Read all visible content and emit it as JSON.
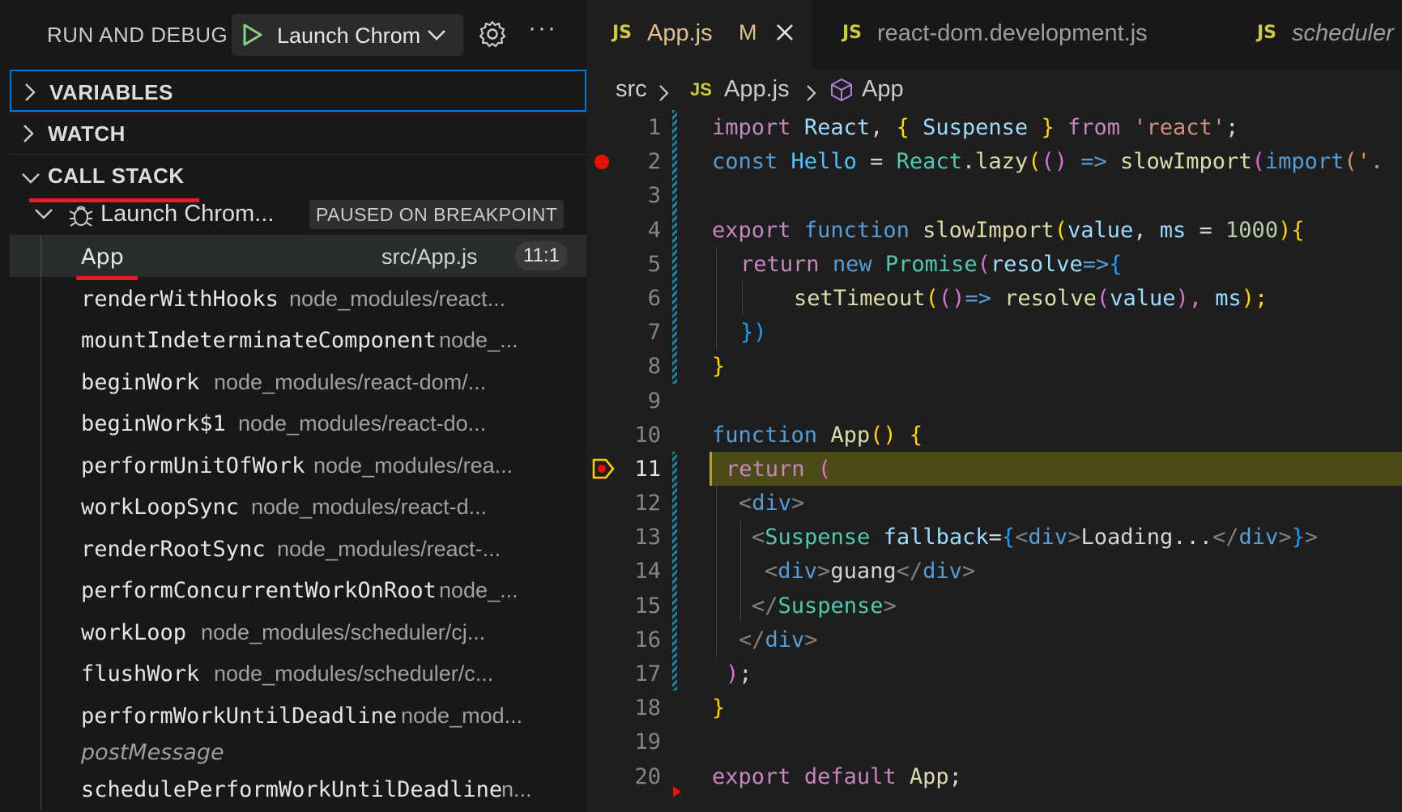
{
  "sidebar": {
    "title": "RUN AND DEBUG",
    "launch_config": "Launch Chrom",
    "sections": {
      "variables": "VARIABLES",
      "watch": "WATCH",
      "call_stack": "CALL STACK"
    },
    "session": {
      "name": "Launch Chrom...",
      "status": "PAUSED ON BREAKPOINT"
    },
    "frames": [
      {
        "name": "App",
        "source": "src/App.js",
        "line": "11:1"
      },
      {
        "name": "renderWithHooks",
        "source": "node_modules/react..."
      },
      {
        "name": "mountIndeterminateComponent",
        "source": "node_..."
      },
      {
        "name": "beginWork",
        "source": "node_modules/react-dom/..."
      },
      {
        "name": "beginWork$1",
        "source": "node_modules/react-do..."
      },
      {
        "name": "performUnitOfWork",
        "source": "node_modules/rea..."
      },
      {
        "name": "workLoopSync",
        "source": "node_modules/react-d..."
      },
      {
        "name": "renderRootSync",
        "source": "node_modules/react-..."
      },
      {
        "name": "performConcurrentWorkOnRoot",
        "source": "node_..."
      },
      {
        "name": "workLoop",
        "source": "node_modules/scheduler/cj..."
      },
      {
        "name": "flushWork",
        "source": "node_modules/scheduler/c..."
      },
      {
        "name": "performWorkUntilDeadline",
        "source": "node_mod..."
      },
      {
        "name": "postMessage",
        "source": ""
      },
      {
        "name": "schedulePerformWorkUntilDeadline",
        "source": "n..."
      }
    ]
  },
  "editor": {
    "tabs": [
      {
        "icon": "JS",
        "name": "App.js",
        "badge": "M"
      },
      {
        "icon": "JS",
        "name": "react-dom.development.js"
      },
      {
        "icon": "JS",
        "name": "scheduler"
      }
    ],
    "breadcrumb": {
      "folder": "src",
      "file_icon": "JS",
      "file": "App.js",
      "symbol": "App"
    },
    "line_numbers": [
      "1",
      "2",
      "3",
      "4",
      "5",
      "6",
      "7",
      "8",
      "9",
      "10",
      "11",
      "12",
      "13",
      "14",
      "15",
      "16",
      "17",
      "18",
      "19",
      "20"
    ],
    "code": {
      "l1": [
        "import",
        " ",
        "React",
        ", ",
        "{",
        " ",
        "Suspense",
        " ",
        "}",
        " ",
        "from",
        " ",
        "'react'",
        ";"
      ],
      "l2": [
        "const",
        " ",
        "Hello",
        " = ",
        "React",
        ".",
        "lazy",
        "(",
        "()",
        " ",
        "=>",
        " ",
        "slowImport",
        "(",
        "import",
        "('."
      ],
      "l4": [
        "export",
        " ",
        "function",
        " ",
        "slowImport",
        "(",
        "value",
        ", ",
        "ms",
        " = ",
        "1000",
        ")",
        "{"
      ],
      "l5": [
        "return",
        " ",
        "new",
        " ",
        "Promise",
        "(",
        "resolve",
        "=>",
        "{"
      ],
      "l6": [
        "setTimeout",
        "(",
        "()",
        "=>",
        " ",
        "resolve",
        "(",
        "value",
        "), ",
        "ms",
        ");"
      ],
      "l7": [
        "})"
      ],
      "l8": [
        "}"
      ],
      "l10": [
        "function",
        " ",
        "App",
        "()",
        " ",
        "{"
      ],
      "l11": [
        "return",
        " ",
        "("
      ],
      "l12": [
        "<",
        "div",
        ">"
      ],
      "l13": [
        "<",
        "Suspense",
        " ",
        "fallback",
        "=",
        "{",
        "<",
        "div",
        ">",
        "Loading...",
        "</",
        "div",
        ">",
        "}",
        ">"
      ],
      "l14": [
        "<",
        "div",
        ">",
        "guang",
        "</",
        "div",
        ">"
      ],
      "l15": [
        "</",
        "Suspense",
        ">"
      ],
      "l16": [
        "</",
        "div",
        ">"
      ],
      "l17": [
        ")",
        ";"
      ],
      "l18": [
        "}"
      ],
      "l20": [
        "export",
        " ",
        "default",
        " ",
        "App",
        ";"
      ]
    }
  },
  "colors": {
    "accent_focus": "#0078d4",
    "breakpoint": "#e51400",
    "current_line": "#4b4b18",
    "annotation_red": "#e51c23"
  },
  "icons": [
    "play-icon",
    "chevron-down-icon",
    "gear-icon",
    "more-icon",
    "chevron-right-icon",
    "bug-icon",
    "close-icon",
    "symbol-class-icon",
    "breakpoint-icon",
    "current-breakpoint-icon"
  ]
}
